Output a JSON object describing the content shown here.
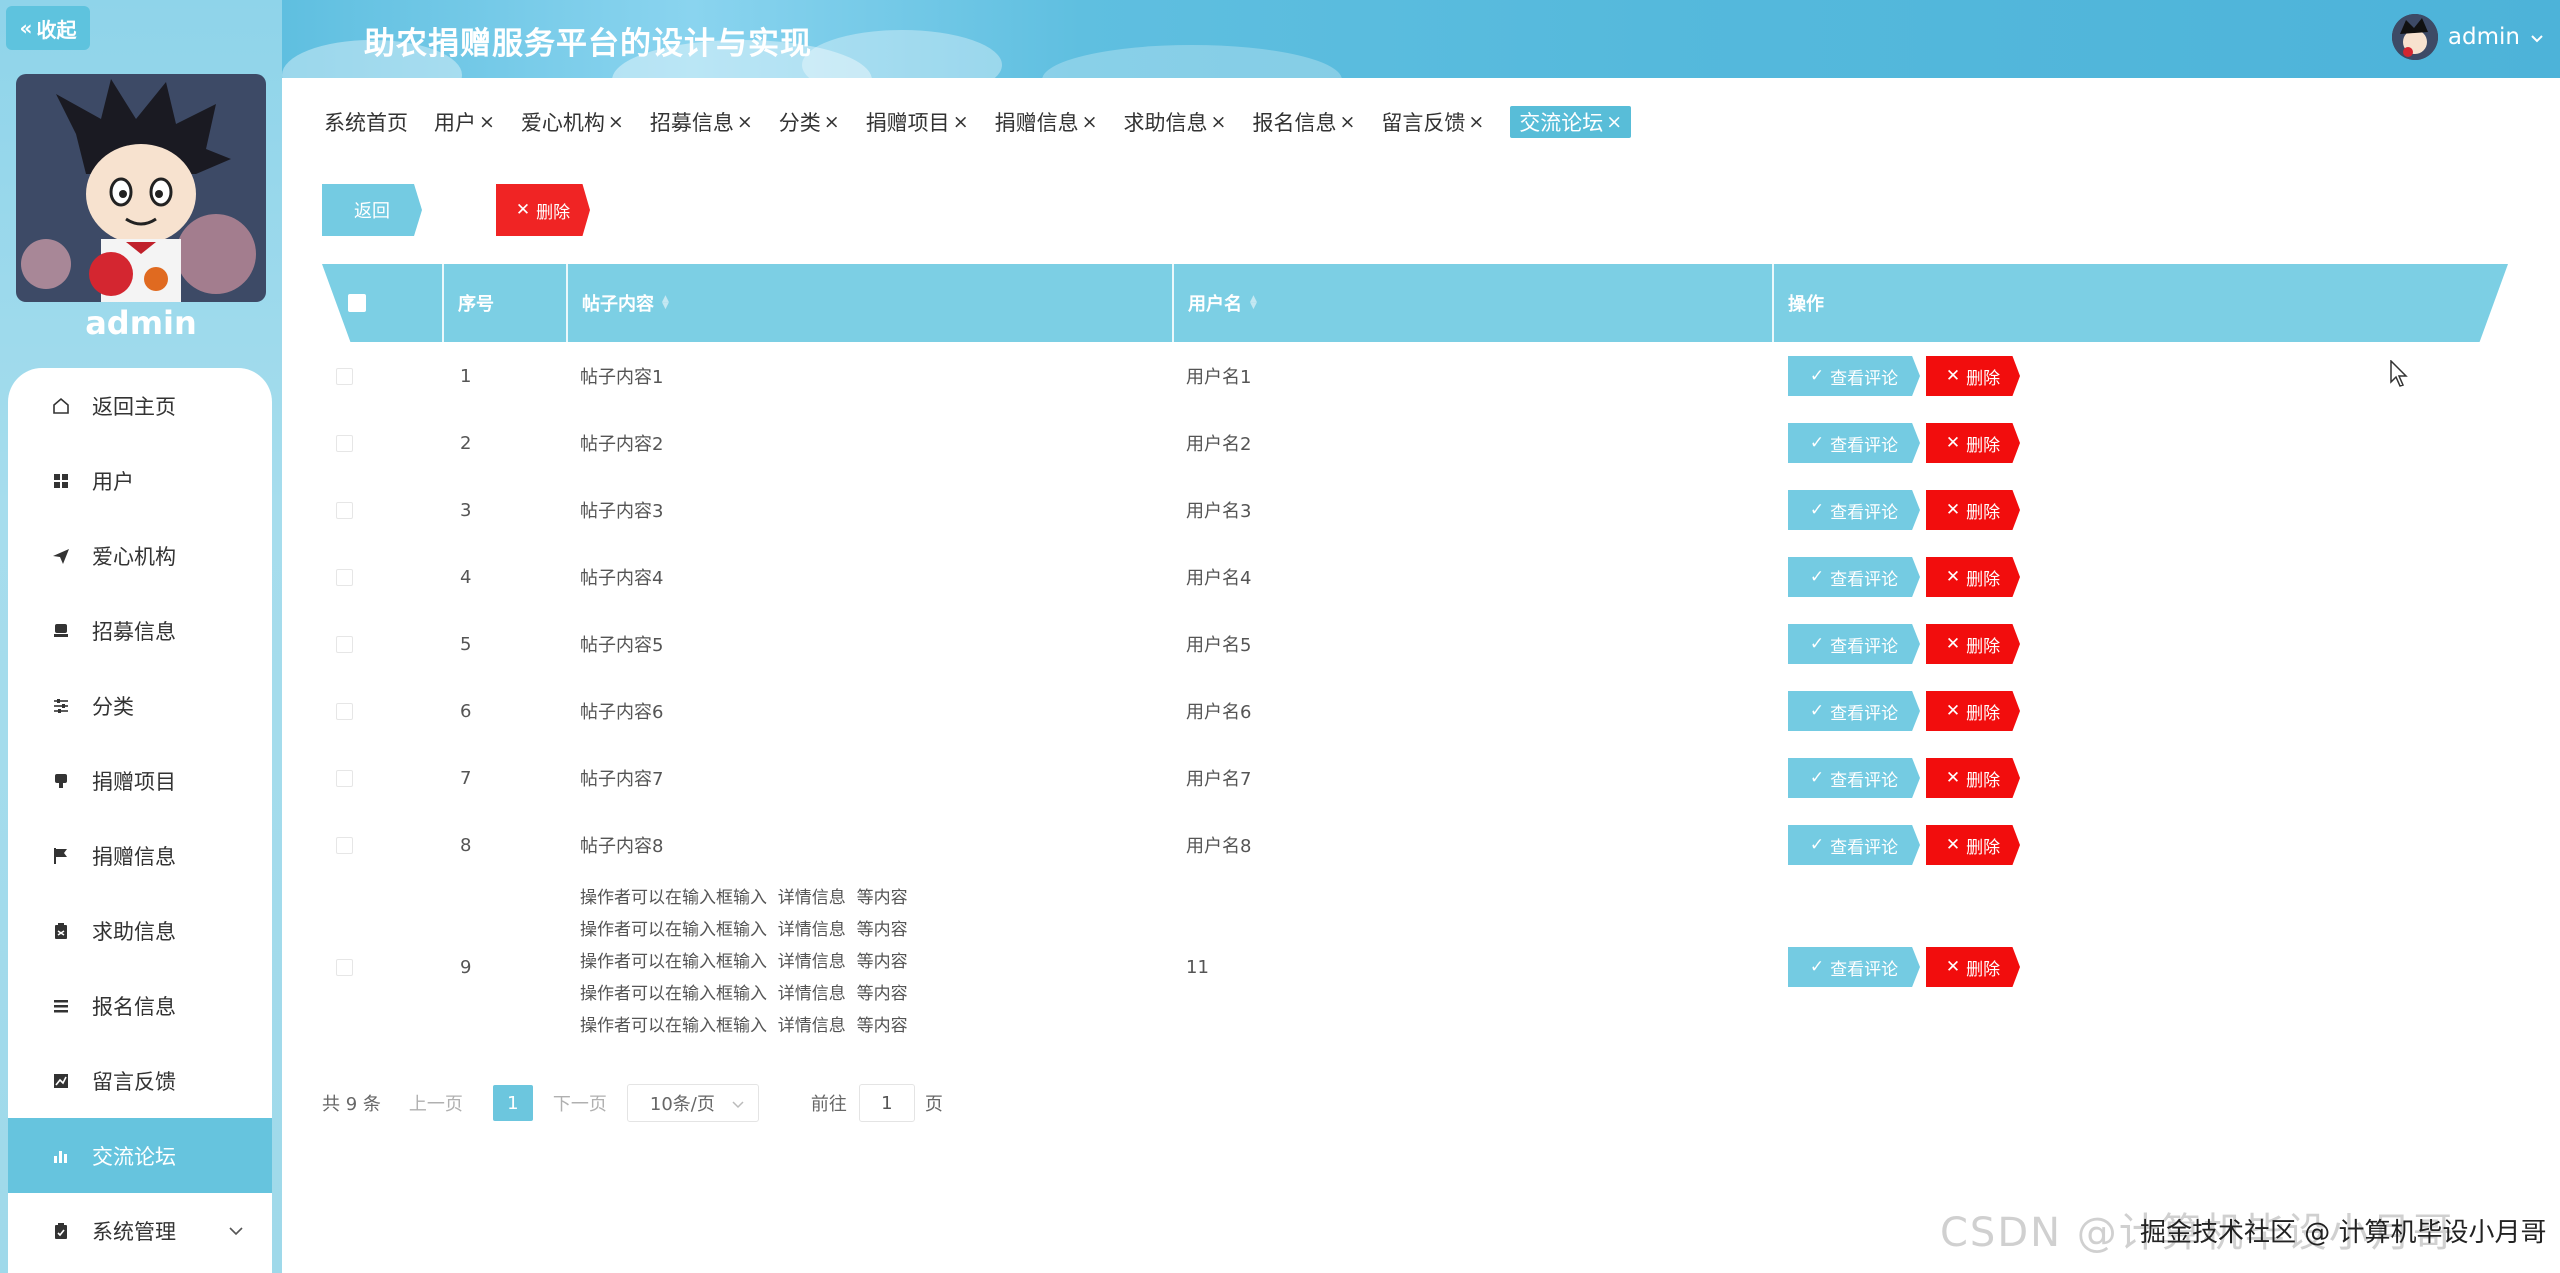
{
  "sidebar": {
    "collapse_label": "收起",
    "username": "admin",
    "menu": [
      {
        "label": "返回主页",
        "icon": "home-icon"
      },
      {
        "label": "用户",
        "icon": "grid-icon"
      },
      {
        "label": "爱心机构",
        "icon": "send-icon"
      },
      {
        "label": "招募信息",
        "icon": "stamp-icon"
      },
      {
        "label": "分类",
        "icon": "sliders-icon"
      },
      {
        "label": "捐赠项目",
        "icon": "stamp-icon"
      },
      {
        "label": "捐赠信息",
        "icon": "flag-icon"
      },
      {
        "label": "求助信息",
        "icon": "clipboard-icon"
      },
      {
        "label": "报名信息",
        "icon": "list-icon"
      },
      {
        "label": "留言反馈",
        "icon": "chart-line-icon"
      },
      {
        "label": "交流论坛",
        "icon": "bar-chart-icon"
      },
      {
        "label": "系统管理",
        "icon": "clipboard-check-icon"
      }
    ],
    "active_index": 10
  },
  "header": {
    "title": "助农捐赠服务平台的设计与实现",
    "user": "admin"
  },
  "tabs": [
    {
      "label": "系统首页",
      "closable": false
    },
    {
      "label": "用户",
      "closable": true
    },
    {
      "label": "爱心机构",
      "closable": true
    },
    {
      "label": "招募信息",
      "closable": true
    },
    {
      "label": "分类",
      "closable": true
    },
    {
      "label": "捐赠项目",
      "closable": true
    },
    {
      "label": "捐赠信息",
      "closable": true
    },
    {
      "label": "求助信息",
      "closable": true
    },
    {
      "label": "报名信息",
      "closable": true
    },
    {
      "label": "留言反馈",
      "closable": true
    },
    {
      "label": "交流论坛",
      "closable": true,
      "active": true
    }
  ],
  "actions": {
    "back_label": "返回",
    "delete_label": "删除"
  },
  "table": {
    "columns": [
      "序号",
      "帖子内容",
      "用户名",
      "操作"
    ],
    "view_label": "查看评论",
    "delete_label": "删除",
    "rows": [
      {
        "index": "1",
        "content": "帖子内容1",
        "username": "用户名1"
      },
      {
        "index": "2",
        "content": "帖子内容2",
        "username": "用户名2"
      },
      {
        "index": "3",
        "content": "帖子内容3",
        "username": "用户名3"
      },
      {
        "index": "4",
        "content": "帖子内容4",
        "username": "用户名4"
      },
      {
        "index": "5",
        "content": "帖子内容5",
        "username": "用户名5"
      },
      {
        "index": "6",
        "content": "帖子内容6",
        "username": "用户名6"
      },
      {
        "index": "7",
        "content": "帖子内容7",
        "username": "用户名7"
      },
      {
        "index": "8",
        "content": "帖子内容8",
        "username": "用户名8"
      },
      {
        "index": "9",
        "content_lines": [
          "操作者可以在输入框输入  详情信息  等内容",
          "操作者可以在输入框输入  详情信息  等内容",
          "操作者可以在输入框输入  详情信息  等内容",
          "操作者可以在输入框输入  详情信息  等内容",
          "操作者可以在输入框输入  详情信息  等内容"
        ],
        "username": "11"
      }
    ]
  },
  "pagination": {
    "total": "共 9 条",
    "prev": "上一页",
    "current": "1",
    "next": "下一页",
    "page_size": "10条/页",
    "goto_label": "前往",
    "goto_value": "1",
    "page_unit": "页"
  },
  "watermark": {
    "text": "CSDN @计算机毕设小月哥",
    "overlay": "掘金技术社区 @ 计算机毕设小月哥"
  },
  "colors": {
    "accent": "#66c4de",
    "header_bg": "#7ccfe4",
    "danger": "#f02424"
  }
}
